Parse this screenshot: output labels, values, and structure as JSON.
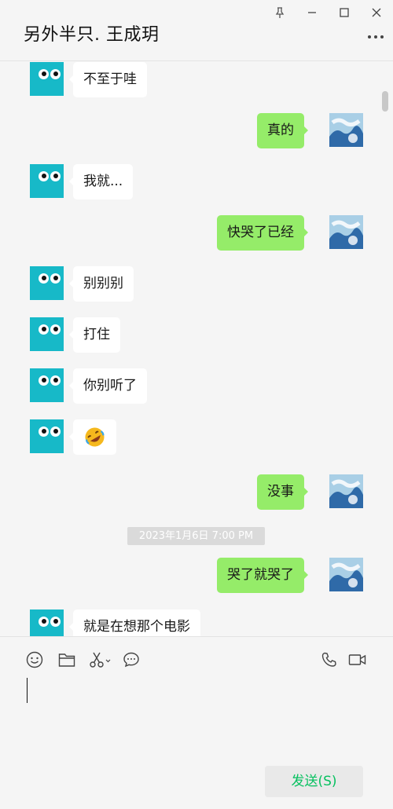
{
  "window": {
    "title": "另外半只. 王成玥"
  },
  "controls": {
    "pin_icon": "pin-icon",
    "minimize_icon": "minimize-icon",
    "maximize_icon": "maximize-icon",
    "close_icon": "close-icon",
    "more_icon": "more-icon"
  },
  "messages": [
    {
      "side": "left",
      "text": "不至于哇"
    },
    {
      "side": "right",
      "text": "真的"
    },
    {
      "side": "left",
      "text": "我就..."
    },
    {
      "side": "right",
      "text": "快哭了已经"
    },
    {
      "side": "left",
      "text": "别别别"
    },
    {
      "side": "left",
      "text": "打住"
    },
    {
      "side": "left",
      "text": "你别听了"
    },
    {
      "side": "left",
      "emoji": "rolling-on-floor-laughing-emoji"
    },
    {
      "side": "right",
      "text": "没事"
    },
    {
      "timestamp": "2023年1月6日 7:00 PM"
    },
    {
      "side": "right",
      "text": "哭了就哭了"
    },
    {
      "side": "left",
      "text": "就是在想那个电影"
    }
  ],
  "toolbar": {
    "emoji_icon": "emoji-icon",
    "folder_icon": "folder-icon",
    "scissors_icon": "scissors-icon",
    "chat_icon": "chat-bubble-icon",
    "phone_icon": "phone-icon",
    "video_icon": "video-icon"
  },
  "composer": {
    "value": "",
    "send_label": "发送(S)"
  },
  "colors": {
    "outgoing_bubble": "#95ec69",
    "incoming_bubble": "#ffffff",
    "background": "#f5f5f5",
    "send_text": "#07c160",
    "avatar_left": "#17b9c8"
  }
}
